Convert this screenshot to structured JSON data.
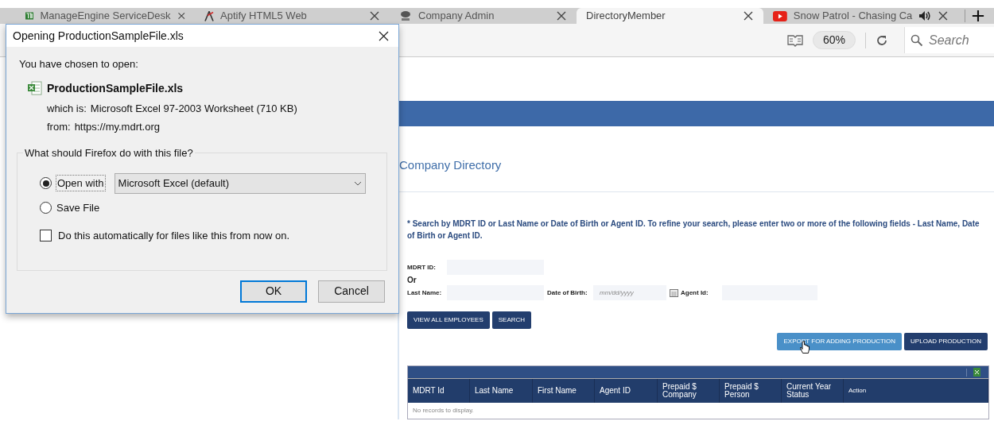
{
  "browser": {
    "tabs": [
      {
        "title": "ManageEngine ServiceDesk",
        "selected": false
      },
      {
        "title": "Aptify HTML5 Web",
        "selected": false
      },
      {
        "title": "Company Admin",
        "selected": false
      },
      {
        "title": "DirectoryMember",
        "selected": true
      },
      {
        "title": "Snow Patrol - Chasing Ca",
        "selected": false
      }
    ],
    "zoom": "60%",
    "search": {
      "placeholder": "Search"
    }
  },
  "page": {
    "heading": "Company Directory",
    "instructions": "* Search by MDRT ID or Last Name or Date of Birth or Agent ID. To refine your search, please enter two or more of the following fields - Last Name, Date of Birth or Agent ID.",
    "mdrt_id": {
      "label": "MDRT ID:"
    },
    "or": "Or",
    "last_name": {
      "label": "Last Name:"
    },
    "date_of_birth": {
      "label": "Date of Birth:",
      "placeholder": "mm/dd/yyyy"
    },
    "agent_id": {
      "label": "Agent Id:"
    },
    "search_buttons": [
      "VIEW ALL EMPLOYEES",
      "SEARCH"
    ],
    "action_buttons": [
      {
        "label": "EXPORT FOR ADDING PRODUCTION",
        "hovered": true
      },
      {
        "label": "UPLOAD PRODUCTION",
        "hovered": false
      }
    ],
    "table": {
      "columns": [
        "MDRT Id",
        "Last Name",
        "First Name",
        "Agent ID",
        "Prepaid $ Company",
        "Prepaid $ Person",
        "Current Year Status",
        "Action"
      ],
      "empty_message": "No records to display."
    }
  },
  "dialog": {
    "title": "Opening ProductionSampleFile.xls",
    "intro": "You have chosen to open:",
    "file_name": "ProductionSampleFile.xls",
    "type_label": "which is:",
    "type_value": "Microsoft Excel 97-2003 Worksheet (710 KB)",
    "from_label": "from:",
    "from_value": "https://my.mdrt.org",
    "group_label": "What should Firefox do with this file?",
    "options": [
      {
        "label": "Open with",
        "selected": true
      },
      {
        "label": "Save File",
        "selected": false
      }
    ],
    "application": "Microsoft Excel (default)",
    "remember": {
      "label": "Do this automatically for files like this from now on.",
      "checked": false
    },
    "buttons": [
      {
        "label": "OK",
        "default": true
      },
      {
        "label": "Cancel",
        "default": false
      }
    ]
  }
}
